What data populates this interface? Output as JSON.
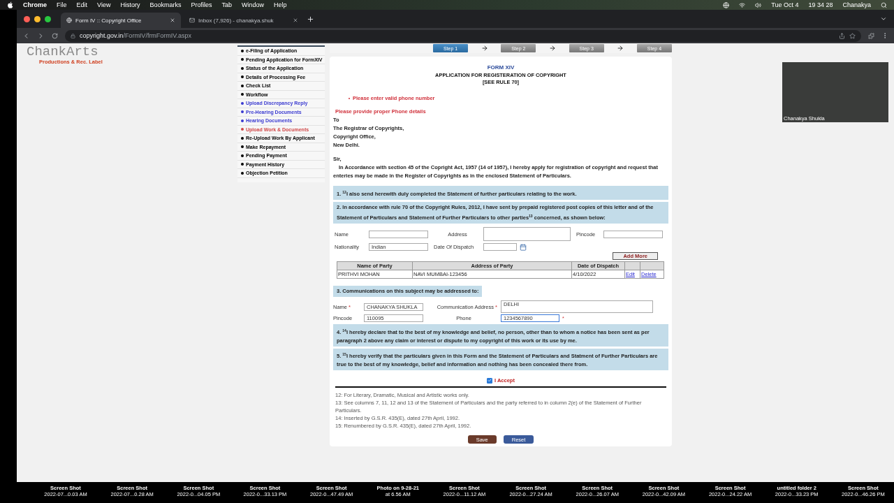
{
  "menubar": {
    "items": [
      {
        "label": "Chrome",
        "bold": true
      },
      {
        "label": "File",
        "bold": false
      },
      {
        "label": "Edit",
        "bold": false
      },
      {
        "label": "View",
        "bold": false
      },
      {
        "label": "History",
        "bold": false
      },
      {
        "label": "Bookmarks",
        "bold": false
      },
      {
        "label": "Profiles",
        "bold": false
      },
      {
        "label": "Tab",
        "bold": false
      },
      {
        "label": "Window",
        "bold": false
      },
      {
        "label": "Help",
        "bold": false
      }
    ],
    "date": "Tue Oct 4",
    "time": "19 34 28",
    "user": "Chanakya"
  },
  "browser": {
    "tabs": [
      {
        "title": "Form IV :: Copyright Office",
        "selected": true
      },
      {
        "title": "Inbox (7,926) - chanakya.shuk",
        "selected": false
      }
    ],
    "url": {
      "host": "copyright.gov.in",
      "path": "/FormIV/frmFormIV.aspx"
    }
  },
  "logo": {
    "name": "ChankArts",
    "tagline": "Productions & Rec. Label"
  },
  "sidebar": {
    "items": [
      {
        "label": "e-Filing of Application",
        "color": "#000000"
      },
      {
        "label": "Pending Application for FormXIV",
        "color": "#000000"
      },
      {
        "label": "Status of the Application",
        "color": "#000000"
      },
      {
        "label": "Details of Processing Fee",
        "color": "#000000"
      },
      {
        "label": "Check List",
        "color": "#000000"
      },
      {
        "label": "Workflow",
        "color": "#000000"
      },
      {
        "label": "Upload Discrepancy Reply",
        "color": "#3a3ad0"
      },
      {
        "label": "Pre-Hearing Documents",
        "color": "#3a3ad0"
      },
      {
        "label": "Hearing Documents",
        "color": "#3a3ad0"
      },
      {
        "label": "Upload Work & Documents",
        "color": "#d04848"
      },
      {
        "label": "Re-Upload Work By Applicant",
        "color": "#000000"
      },
      {
        "label": "Make Repayment",
        "color": "#000000"
      },
      {
        "label": "Pending Payment",
        "color": "#000000"
      },
      {
        "label": "Payment History",
        "color": "#000000"
      },
      {
        "label": "Objection Petition",
        "color": "#000000"
      }
    ]
  },
  "steps": [
    {
      "label": "Step 1",
      "selected": true
    },
    {
      "label": "Step 2",
      "selected": false
    },
    {
      "label": "Step 3",
      "selected": false
    },
    {
      "label": "Step 4",
      "selected": false
    }
  ],
  "form": {
    "title": "FORM XIV",
    "heading": "APPLICATION FOR REGISTERATION OF COPYRIGHT",
    "rule": "[SEE RULE 70]",
    "errors": [
      "Please enter valid phone number"
    ],
    "error_summary": "Please provide proper Phone details",
    "address_lines": [
      "To",
      "The Registrar of Copyrights,",
      "Copyright Office,",
      "New Delhi."
    ],
    "salutation": "Sir,",
    "intro": "In Accordance with section 45 of the Copright Act, 1957 (14 of 1957), I hereby apply for registration of copyright and request that enteries may be made in the Register of Copyrights as in the enclosed Statement of Particulars.",
    "section_1": "1. $^{12}$I also send herewith duly completed the Statement of further particulars relating to the work.",
    "section_2": "2. In accordance with rule 70 of the Copyright Rules, 2012, I have sent by prepaid registered post copies of this letter and of the Statement of Particulars and Statement of Further Particulars to other parties$^{13}$ concerned, as shown below:",
    "party_fields": {
      "name_label": "Name",
      "address_label": "Address",
      "pincode_label": "Pincode",
      "nationality_label": "Nationality",
      "nationality": "Indian",
      "dispatch_label": "Date Of Dispatch",
      "add_button": "Add More"
    },
    "parties_table": {
      "columns": [
        "Name of Party",
        "Address of Party",
        "Date of Dispatch"
      ],
      "rows": [
        {
          "cells": [
            "PRITHVI MOHAN",
            "NAVI MUMBAI-123456",
            "4/10/2022"
          ],
          "actions": [
            "Edit",
            "Delete"
          ]
        }
      ]
    },
    "section_3": "3.  Communications on this subject may be addressed to:",
    "contact": {
      "name_label": "Name",
      "name": "CHANAKYA SHUKLA",
      "address_label": "Communication Address",
      "address": "DELHI",
      "pincode_label": "Pincode",
      "pincode": "110095",
      "phone_label": "Phone",
      "phone": "1234567890",
      "required_mark": "*"
    },
    "section_4": "4. $^{14}$I hereby declare that to the best of my knowledge and belief, no person, other than to whom a notice has been sent as per paragraph 2 above any claim or interest or dispute to my copyright of this work or its use by me.",
    "section_5": "5. $^{15}$I hereby verify that the particulars given in this Form and the Statement of Particulars and Statment of Further Particulars are true to the best of my knowledge, belief and information and nothing has been concealed there from.",
    "accept": {
      "label": "I Accept",
      "checked": true
    },
    "footnotes": [
      "12: For Literary, Dramatic, Musical and Artistic works only.",
      "13: See columns 7, 11, 12 and 13 of the Statement of Particulars and the party referred to in column 2(e) of the Statement of Further Particulars.",
      "14: Inserted by G.S.R. 435(E), dated 27th April, 1992.",
      "15: Renumbered by G.S.R. 435(E), dated 27th April, 1992."
    ],
    "buttons": [
      "Save",
      "Reset"
    ]
  },
  "webcam": {
    "name": "Chanakya Shukla"
  },
  "desktop_files": [
    {
      "name": "Screen Shot",
      "date": "2022-07...0.03 AM"
    },
    {
      "name": "Screen Shot",
      "date": "2022-07...0.28 AM"
    },
    {
      "name": "Screen Shot",
      "date": "2022-0...04.05 PM"
    },
    {
      "name": "Screen Shot",
      "date": "2022-0...33.13 PM"
    },
    {
      "name": "Screen Shot",
      "date": "2022-0...47.49 AM"
    },
    {
      "name": "Photo on 9-28-21",
      "date": "at 6.56 AM"
    },
    {
      "name": "Screen Shot",
      "date": "2022-0...11.12 AM"
    },
    {
      "name": "Screen Shot",
      "date": "2022-0...27.24 AM"
    },
    {
      "name": "Screen Shot",
      "date": "2022-0...26.07 AM"
    },
    {
      "name": "Screen Shot",
      "date": "2022-0...42.09 AM"
    },
    {
      "name": "Screen Shot",
      "date": "2022-0...24.22 AM"
    },
    {
      "name": "untitled folder 2",
      "date": "2022-0...33.23 PM"
    },
    {
      "name": "Screen Shot",
      "date": "2022-0...46.26 PM"
    }
  ]
}
